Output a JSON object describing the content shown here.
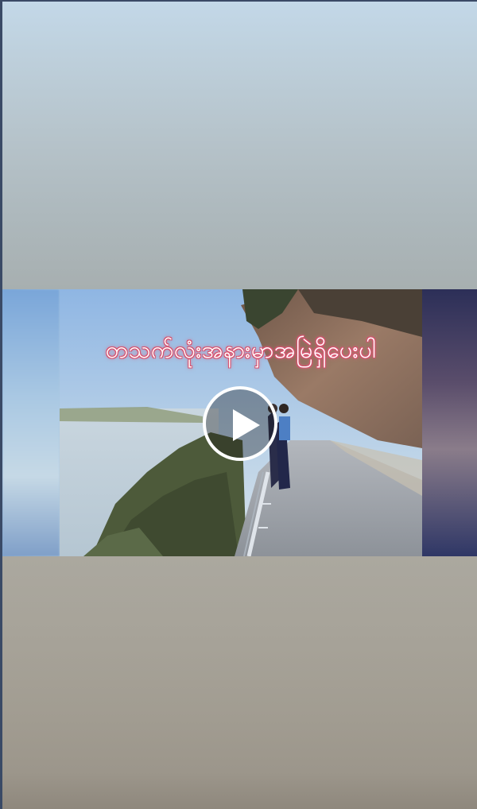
{
  "video": {
    "caption": "တသက်လုံးအနားမှာအမြဲရှိပေးပါ",
    "play_icon": "play-icon"
  },
  "colors": {
    "caption_glow": "#e0607a",
    "play_ring": "#ffffff",
    "frame_border": "#3a4a66"
  }
}
